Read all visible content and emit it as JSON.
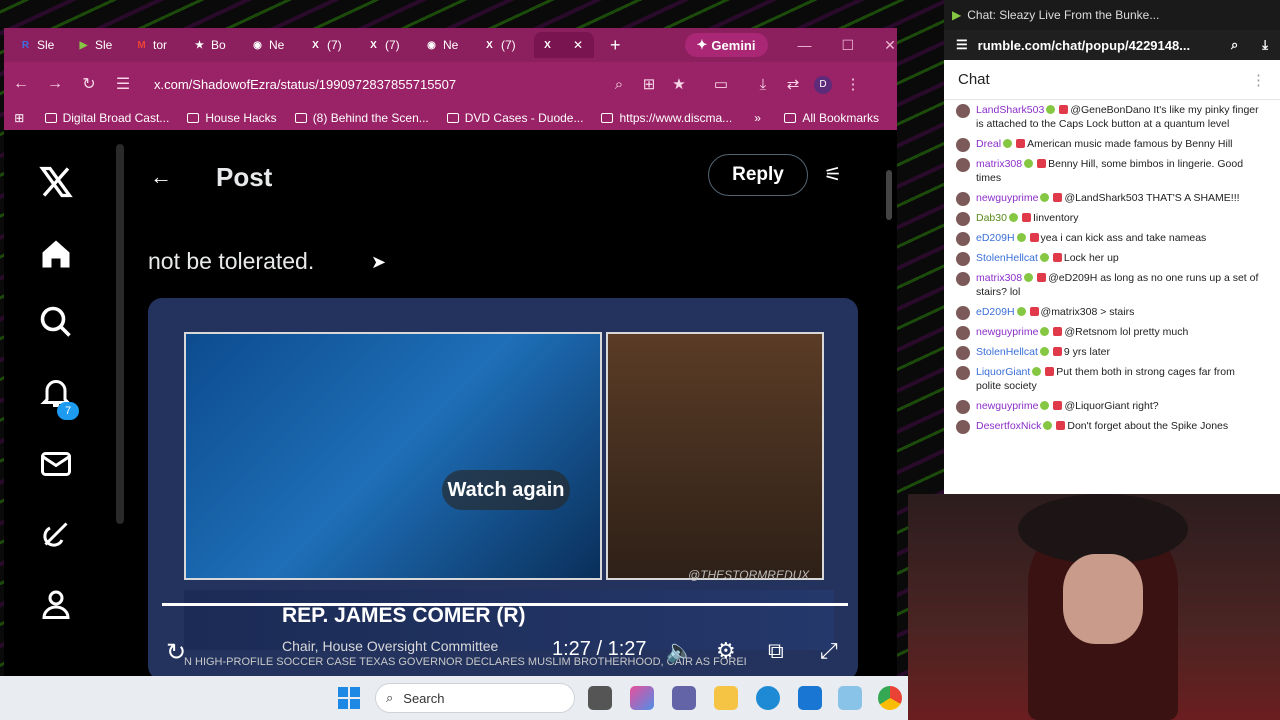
{
  "browser": {
    "tabs": [
      {
        "label": "Sle",
        "icon": "R",
        "color": "#3c6fe0"
      },
      {
        "label": "Sle",
        "icon": "▶",
        "color": "#85c742"
      },
      {
        "label": "tor",
        "icon": "M",
        "color": "#ea4335"
      },
      {
        "label": "Bo",
        "icon": "★",
        "color": "#ffffff"
      },
      {
        "label": "Ne",
        "icon": "◉",
        "color": "#ffffff"
      },
      {
        "label": "(7)",
        "icon": "X",
        "color": "#ffffff"
      },
      {
        "label": "(7)",
        "icon": "X",
        "color": "#ffffff"
      },
      {
        "label": "Ne",
        "icon": "◉",
        "color": "#ffffff"
      },
      {
        "label": "(7)",
        "icon": "X",
        "color": "#ffffff"
      },
      {
        "label": "",
        "icon": "X",
        "color": "#ffffff"
      }
    ],
    "gemini_label": "Gemini",
    "url": "x.com/ShadowofEzra/status/1990972837855715507",
    "avatar_letter": "D",
    "bookmarks": [
      "Digital Broad Cast...",
      "House Hacks",
      "(8) Behind the Scen...",
      "DVD Cases - Duode...",
      "https://www.discma..."
    ],
    "bookmarks_more": "»",
    "all_bookmarks": "All Bookmarks"
  },
  "x": {
    "notification_count": "7",
    "header_title": "Post",
    "reply_label": "Reply",
    "post_text": "not be tolerated.",
    "video": {
      "watch_again": "Watch again",
      "lower_name": "REP. JAMES COMER (R)",
      "lower_sub": "Chair, House Oversight Committee",
      "ticker": "N HIGH-PROFILE SOCCER CASE      TEXAS GOVERNOR DECLARES MUSLIM BROTHERHOOD, CAIR AS FOREI",
      "watermark": "@THESTORMREDUX",
      "time": "1:27 / 1:27",
      "progress": 1.0
    }
  },
  "taskbar": {
    "search_label": "Search"
  },
  "chat": {
    "window_title": "Chat: Sleazy Live From the Bunke...",
    "url": "rumble.com/chat/popup/4229148...",
    "header": "Chat",
    "messages": [
      {
        "user": "LandShark503",
        "text": "@GeneBonDano It's like my pinky finger is attached to the Caps Lock button at a quantum level",
        "color": "#8b2fc9"
      },
      {
        "user": "Dreal",
        "text": "American music made famous by Benny Hill",
        "color": "#8b2fc9"
      },
      {
        "user": "matrix308",
        "text": "Benny Hill, some bimbos in lingerie. Good times",
        "color": "#8b2fc9"
      },
      {
        "user": "newguyprime",
        "text": "@LandShark503 THAT'S A SHAME!!!",
        "color": "#8b2fc9"
      },
      {
        "user": "Dab30",
        "text": "Iinventory",
        "color": "#5a8a1a"
      },
      {
        "user": "eD209H",
        "text": "yea i can kick ass and take nameas",
        "color": "#3a6fd8"
      },
      {
        "user": "StolenHellcat",
        "text": "Lock her up",
        "color": "#3a6fd8"
      },
      {
        "user": "matrix308",
        "text": "@eD209H as long as no one runs up a set of stairs? lol",
        "color": "#8b2fc9"
      },
      {
        "user": "eD209H",
        "text": "@matrix308 > stairs",
        "color": "#3a6fd8"
      },
      {
        "user": "newguyprime",
        "text": "@Retsnom lol pretty much",
        "color": "#8b2fc9"
      },
      {
        "user": "StolenHellcat",
        "text": "9 yrs later",
        "color": "#3a6fd8"
      },
      {
        "user": "LiquorGiant",
        "text": "Put them both in strong cages far from polite society",
        "color": "#3a6fd8"
      },
      {
        "user": "newguyprime",
        "text": "@LiquorGiant right?",
        "color": "#8b2fc9"
      },
      {
        "user": "DesertfoxNick",
        "text": "Don't forget about the Spike Jones",
        "color": "#8b2fc9"
      }
    ]
  }
}
